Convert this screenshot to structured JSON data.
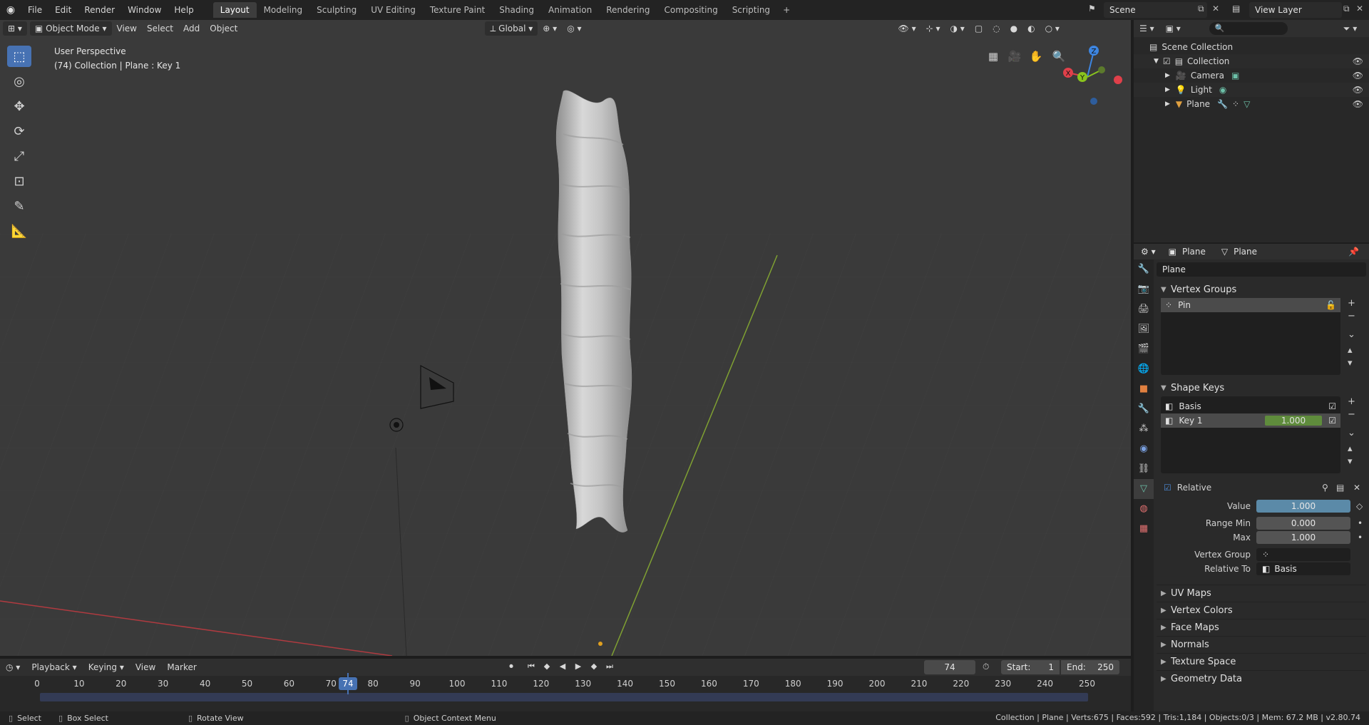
{
  "topbar": {
    "menus": [
      "File",
      "Edit",
      "Render",
      "Window",
      "Help"
    ],
    "workspaces": [
      "Layout",
      "Modeling",
      "Sculpting",
      "UV Editing",
      "Texture Paint",
      "Shading",
      "Animation",
      "Rendering",
      "Compositing",
      "Scripting"
    ],
    "active_workspace": "Layout",
    "add_tab": "+",
    "scene": "Scene",
    "view_layer": "View Layer"
  },
  "viewport": {
    "mode": "Object Mode",
    "menus": [
      "View",
      "Select",
      "Add",
      "Object"
    ],
    "orientation": "Global",
    "perspective": "User Perspective",
    "info": "(74) Collection | Plane : Key 1",
    "axis_labels": {
      "z": "Z",
      "y": "Y",
      "x": "X"
    },
    "colors": {
      "x": "#e0404a",
      "y": "#8ac41e",
      "z": "#3d85e0",
      "active_tool": "#4772b3"
    }
  },
  "outliner": {
    "search_placeholder": "",
    "root": "Scene Collection",
    "collection": "Collection",
    "items": [
      {
        "name": "Camera",
        "icon": "camera-icon"
      },
      {
        "name": "Light",
        "icon": "light-icon"
      },
      {
        "name": "Plane",
        "icon": "mesh-icon"
      }
    ]
  },
  "properties": {
    "breadcrumb_object": "Plane",
    "breadcrumb_data": "Plane",
    "data_name": "Plane",
    "vertex_groups_title": "Vertex Groups",
    "vertex_groups": [
      "Pin"
    ],
    "shape_keys_title": "Shape Keys",
    "shape_keys": [
      {
        "name": "Basis",
        "value": ""
      },
      {
        "name": "Key 1",
        "value": "1.000"
      }
    ],
    "relative_label": "Relative",
    "value_label": "Value",
    "value": "1.000",
    "range_min_label": "Range Min",
    "range_min": "0.000",
    "max_label": "Max",
    "max": "1.000",
    "vertex_group_label": "Vertex Group",
    "relative_to_label": "Relative To",
    "relative_to": "Basis",
    "collapsed_panels": [
      "UV Maps",
      "Vertex Colors",
      "Face Maps",
      "Normals",
      "Texture Space",
      "Geometry Data"
    ]
  },
  "timeline": {
    "menus": [
      "Playback",
      "Keying",
      "View",
      "Marker"
    ],
    "current_frame": "74",
    "start_label": "Start:",
    "start": "1",
    "end_label": "End:",
    "end": "250",
    "ticks": [
      "0",
      "10",
      "20",
      "30",
      "40",
      "50",
      "60",
      "70",
      "80",
      "90",
      "100",
      "110",
      "120",
      "130",
      "140",
      "150",
      "160",
      "170",
      "180",
      "190",
      "200",
      "210",
      "220",
      "230",
      "240",
      "250"
    ]
  },
  "statusbar": {
    "select": "Select",
    "box_select": "Box Select",
    "rotate_view": "Rotate View",
    "context_menu": "Object Context Menu",
    "stats": "Collection | Plane | Verts:675 | Faces:592 | Tris:1,184 | Objects:0/3 | Mem: 67.2 MB | v2.80.74"
  }
}
